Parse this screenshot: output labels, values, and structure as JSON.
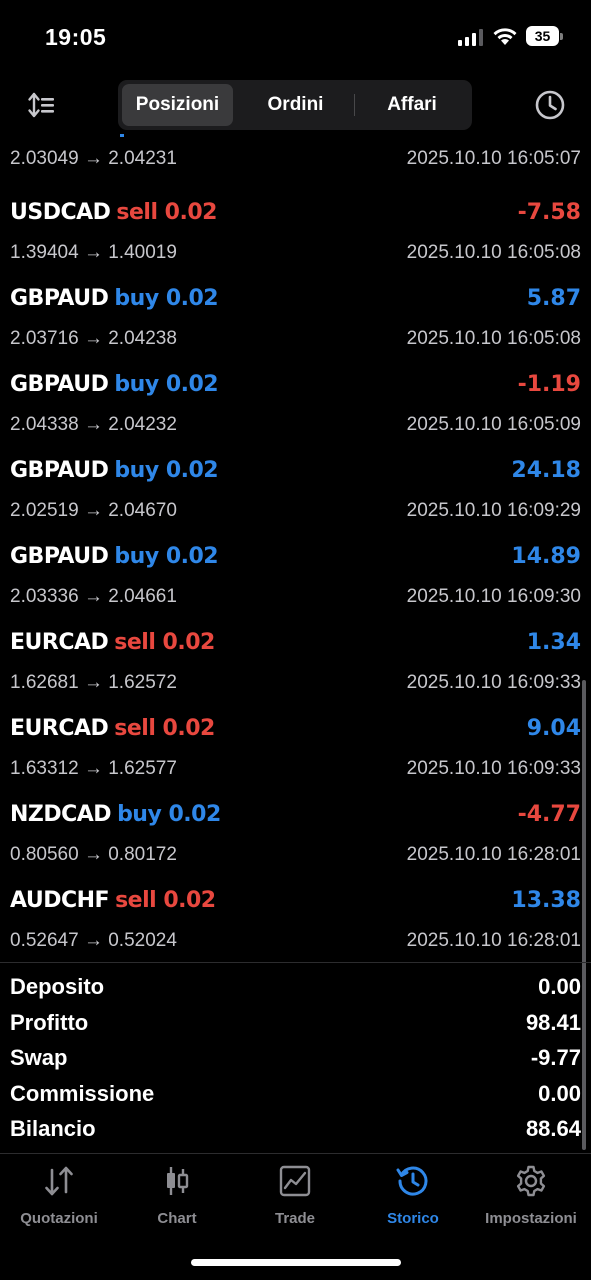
{
  "status_bar": {
    "time": "19:05",
    "battery": "35"
  },
  "toolbar": {
    "segments": [
      {
        "label": "Posizioni",
        "active": true
      },
      {
        "label": "Ordini",
        "active": false
      },
      {
        "label": "Affari",
        "active": false
      }
    ],
    "left_icon": "sort-icon",
    "right_icon": "history-clock-icon"
  },
  "partial_row": {
    "prices": "2.03049 → 2.04231",
    "time": "2025.10.10 16:05:07"
  },
  "trades": [
    {
      "pair": "USDCAD",
      "side": "sell 0.02",
      "prices": "1.39404 → 1.40019",
      "profit": "-7.58",
      "time": "2025.10.10 16:05:08"
    },
    {
      "pair": "GBPAUD",
      "side": "buy 0.02",
      "prices": "2.03716 → 2.04238",
      "profit": "5.87",
      "time": "2025.10.10 16:05:08"
    },
    {
      "pair": "GBPAUD",
      "side": "buy 0.02",
      "prices": "2.04338 → 2.04232",
      "profit": "-1.19",
      "time": "2025.10.10 16:05:09"
    },
    {
      "pair": "GBPAUD",
      "side": "buy 0.02",
      "prices": "2.02519 → 2.04670",
      "profit": "24.18",
      "time": "2025.10.10 16:09:29"
    },
    {
      "pair": "GBPAUD",
      "side": "buy 0.02",
      "prices": "2.03336 → 2.04661",
      "profit": "14.89",
      "time": "2025.10.10 16:09:30"
    },
    {
      "pair": "EURCAD",
      "side": "sell 0.02",
      "prices": "1.62681 → 1.62572",
      "profit": "1.34",
      "time": "2025.10.10 16:09:33"
    },
    {
      "pair": "EURCAD",
      "side": "sell 0.02",
      "prices": "1.63312 → 1.62577",
      "profit": "9.04",
      "time": "2025.10.10 16:09:33"
    },
    {
      "pair": "NZDCAD",
      "side": "buy 0.02",
      "prices": "0.80560 → 0.80172",
      "profit": "-4.77",
      "time": "2025.10.10 16:28:01"
    },
    {
      "pair": "AUDCHF",
      "side": "sell 0.02",
      "prices": "0.52647 → 0.52024",
      "profit": "13.38",
      "time": "2025.10.10 16:28:01"
    }
  ],
  "summary": [
    {
      "label": "Deposito",
      "value": "0.00"
    },
    {
      "label": "Profitto",
      "value": "98.41"
    },
    {
      "label": "Swap",
      "value": "-9.77"
    },
    {
      "label": "Commissione",
      "value": "0.00"
    },
    {
      "label": "Bilancio",
      "value": "88.64"
    }
  ],
  "tabbar": [
    {
      "label": "Quotazioni",
      "icon": "quotes-arrows-icon",
      "active": false
    },
    {
      "label": "Chart",
      "icon": "candlestick-icon",
      "active": false
    },
    {
      "label": "Trade",
      "icon": "trade-chart-icon",
      "active": false
    },
    {
      "label": "Storico",
      "icon": "history-icon",
      "active": true
    },
    {
      "label": "Impostazioni",
      "icon": "gear-icon",
      "active": false
    }
  ],
  "colors": {
    "buy": "#2f87e8",
    "sell": "#e8483f",
    "positive": "#2f87e8",
    "negative": "#e8483f",
    "accent": "#2f87e8"
  }
}
